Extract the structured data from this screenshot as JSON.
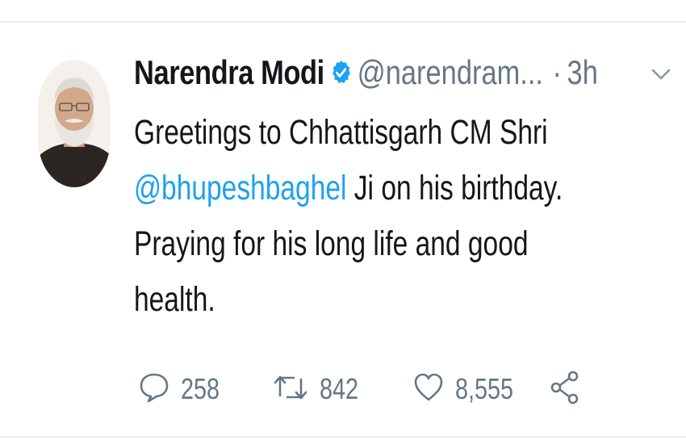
{
  "tweet": {
    "author_name": "Narendra Modi",
    "handle": "@narendram...",
    "separator": "·",
    "time": "3h",
    "text_line1": "Greetings to Chhattisgarh CM Shri",
    "mention": "@bhupeshbaghel",
    "text_line2_rest": " Ji on his birthday.",
    "text_line3": "Praying for his long life and good",
    "text_line4": "health."
  },
  "actions": {
    "replies": "258",
    "retweets": "842",
    "likes": "8,555"
  },
  "icons": {
    "verified": "verified-badge-icon",
    "caret": "chevron-down-icon",
    "reply": "reply-icon",
    "retweet": "retweet-icon",
    "like": "heart-icon",
    "share": "share-icon"
  },
  "colors": {
    "text": "#14171a",
    "secondary": "#657786",
    "accent": "#1da1f2",
    "divider": "#e6ecf0"
  }
}
